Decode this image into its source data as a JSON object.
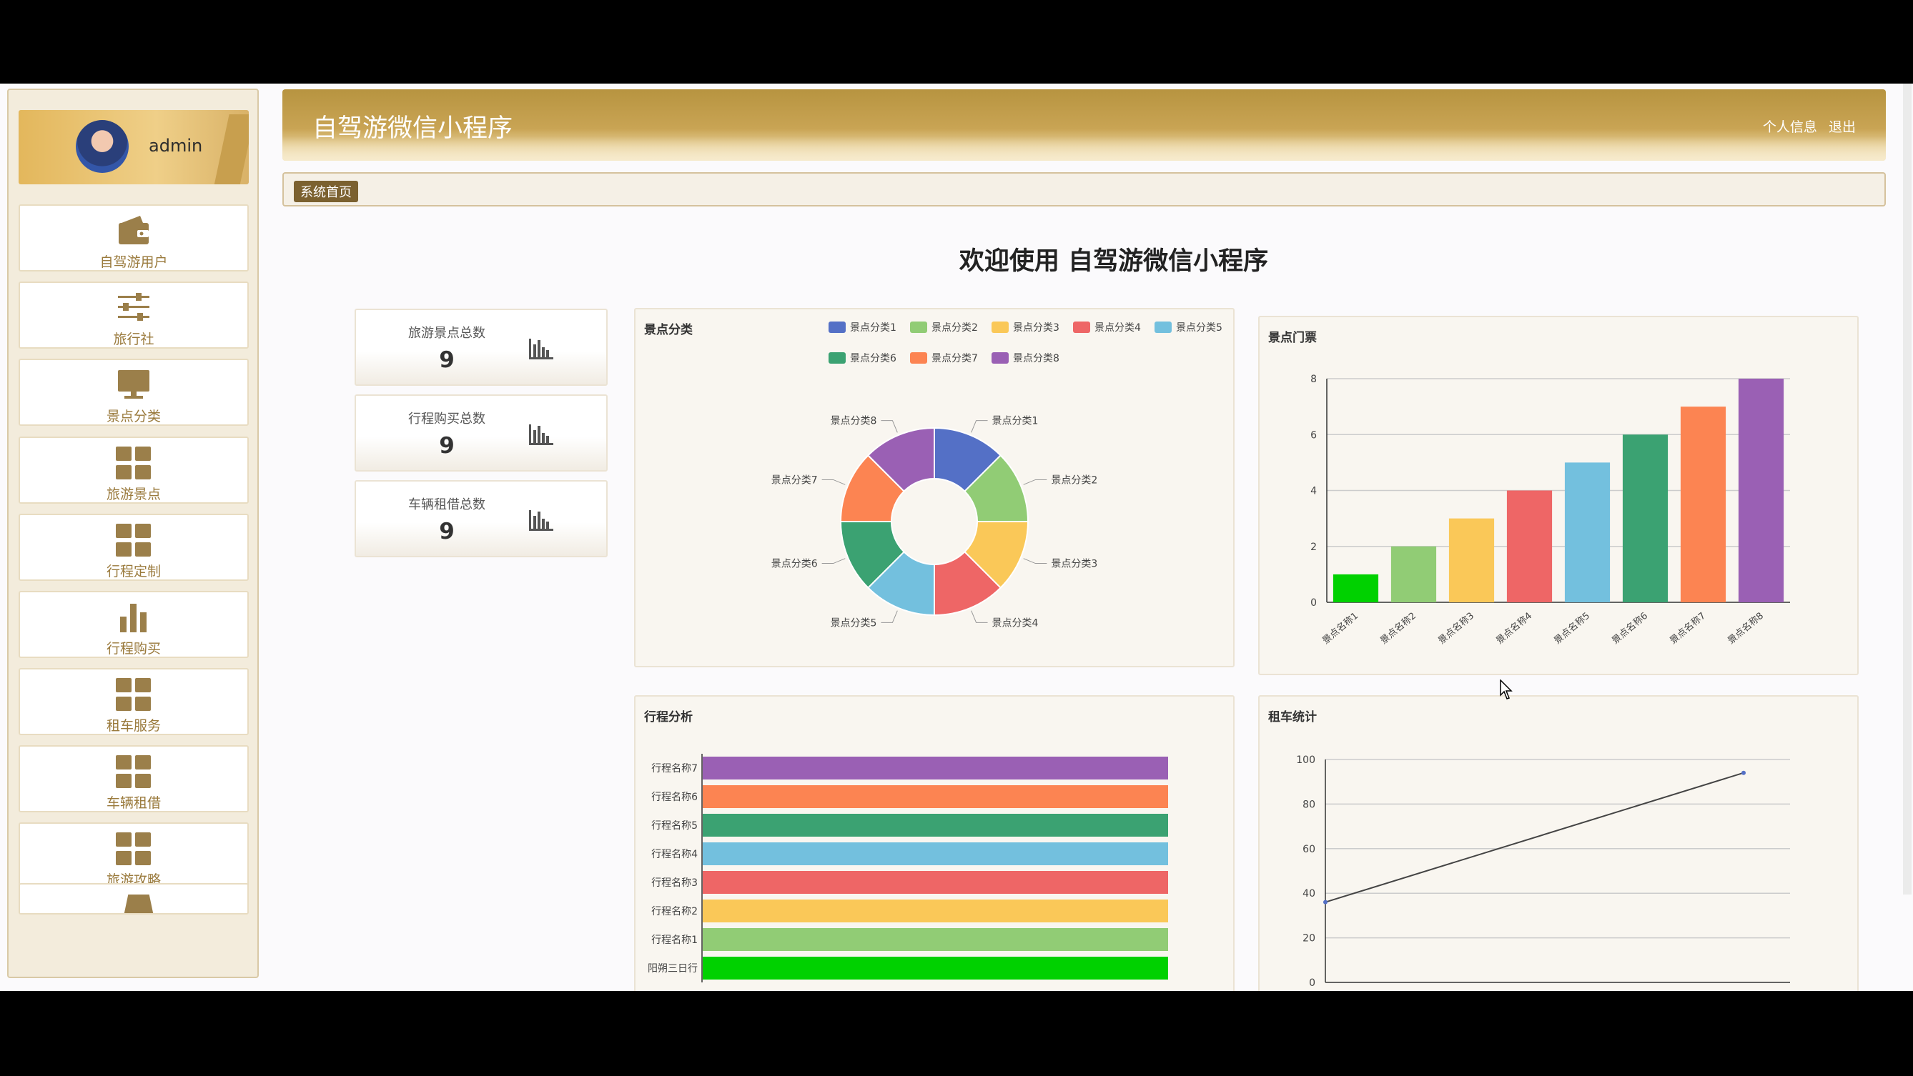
{
  "sidebar": {
    "username": "admin",
    "items": [
      {
        "label": "自驾游用户",
        "icon": "wallet-icon"
      },
      {
        "label": "旅行社",
        "icon": "sliders-icon"
      },
      {
        "label": "景点分类",
        "icon": "monitor-icon"
      },
      {
        "label": "旅游景点",
        "icon": "grid-icon"
      },
      {
        "label": "行程定制",
        "icon": "grid-icon"
      },
      {
        "label": "行程购买",
        "icon": "bar-chart-icon"
      },
      {
        "label": "租车服务",
        "icon": "grid-icon"
      },
      {
        "label": "车辆租借",
        "icon": "grid-icon"
      },
      {
        "label": "旅游攻略",
        "icon": "grid-icon"
      }
    ]
  },
  "header": {
    "title": "自驾游微信小程序",
    "profile_link": "个人信息",
    "logout_link": "退出"
  },
  "breadcrumb": "系统首页",
  "welcome": "欢迎使用 自驾游微信小程序",
  "stats": [
    {
      "title": "旅游景点总数",
      "value": "9"
    },
    {
      "title": "行程购买总数",
      "value": "9"
    },
    {
      "title": "车辆租借总数",
      "value": "9"
    }
  ],
  "colors": [
    "#5470c6",
    "#91cc75",
    "#fac858",
    "#ee6666",
    "#73c0de",
    "#3ba272",
    "#fc8452",
    "#9a60b4"
  ],
  "chart_data": [
    {
      "type": "pie",
      "title": "景点分类",
      "categories": [
        "景点分类1",
        "景点分类2",
        "景点分类3",
        "景点分类4",
        "景点分类5",
        "景点分类6",
        "景点分类7",
        "景点分类8"
      ],
      "values": [
        1,
        1,
        1,
        1,
        1,
        1,
        1,
        1
      ],
      "legend": "top-right"
    },
    {
      "type": "bar",
      "title": "景点门票",
      "categories": [
        "景点名称1",
        "景点名称2",
        "景点名称3",
        "景点名称4",
        "景点名称5",
        "景点名称6",
        "景点名称7",
        "景点名称8"
      ],
      "values": [
        1,
        2,
        3,
        4,
        5,
        6,
        7,
        8
      ],
      "bar_colors": [
        "#00d100",
        "#91cc75",
        "#fac858",
        "#ee6666",
        "#73c0de",
        "#3ba272",
        "#fc8452",
        "#9a60b4"
      ],
      "yticks": [
        "0",
        "2",
        "4",
        "6",
        "8"
      ],
      "ylim": [
        0,
        8
      ],
      "grid": true
    },
    {
      "type": "bar",
      "orientation": "horizontal",
      "title": "行程分析",
      "categories": [
        "阳朔三日行",
        "行程名称1",
        "行程名称2",
        "行程名称3",
        "行程名称4",
        "行程名称5",
        "行程名称6",
        "行程名称7"
      ],
      "values": [
        1,
        1,
        1,
        1,
        1,
        1,
        1,
        1
      ],
      "bar_colors": [
        "#00d100",
        "#91cc75",
        "#fac858",
        "#ee6666",
        "#73c0de",
        "#3ba272",
        "#fc8452",
        "#9a60b4"
      ]
    },
    {
      "type": "line",
      "title": "租车统计",
      "x": [
        0,
        1
      ],
      "values": [
        36,
        94
      ],
      "yticks": [
        "0",
        "20",
        "40",
        "60",
        "80",
        "100"
      ],
      "ylim": [
        0,
        100
      ],
      "grid": true
    }
  ]
}
